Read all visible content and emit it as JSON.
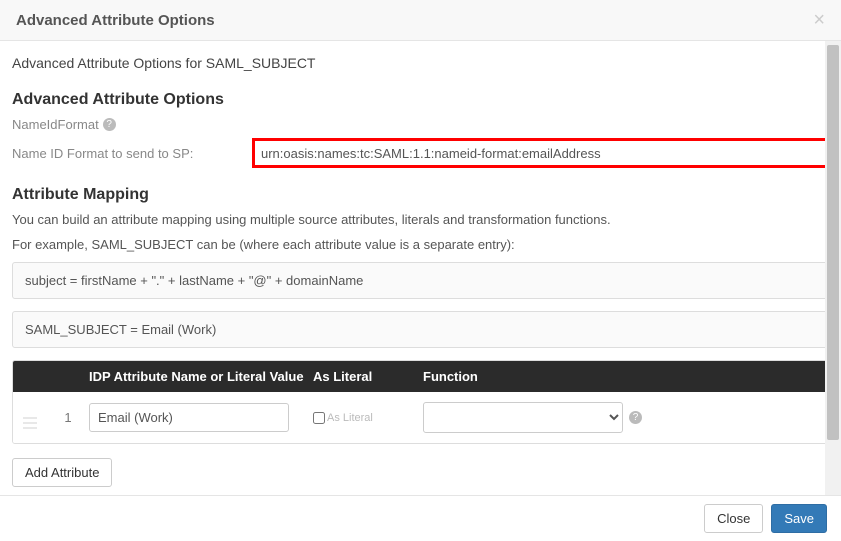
{
  "header": {
    "title": "Advanced Attribute Options"
  },
  "subtitle": "Advanced Attribute Options for SAML_SUBJECT",
  "section1": {
    "heading": "Advanced Attribute Options",
    "nameIdFormatLabel": "NameIdFormat",
    "nameIdSendLabel": "Name ID Format to send to SP:",
    "nameIdValue": "urn:oasis:names:tc:SAML:1.1:nameid-format:emailAddress"
  },
  "section2": {
    "heading": "Attribute Mapping",
    "desc1": "You can build an attribute mapping using multiple source attributes, literals and transformation functions.",
    "desc2": "For example, SAML_SUBJECT can be (where each attribute value is a separate entry):",
    "example1": "subject = firstName + \".\" + lastName + \"@\" + domainName",
    "example2": "SAML_SUBJECT = Email (Work)"
  },
  "table": {
    "headers": {
      "name": "IDP Attribute Name or Literal Value",
      "literal": "As Literal",
      "func": "Function"
    },
    "rows": [
      {
        "index": "1",
        "attr": "Email (Work)",
        "asLiteralLabel": "As Literal",
        "func": ""
      }
    ]
  },
  "buttons": {
    "addAttribute": "Add Attribute",
    "close": "Close",
    "save": "Save"
  }
}
